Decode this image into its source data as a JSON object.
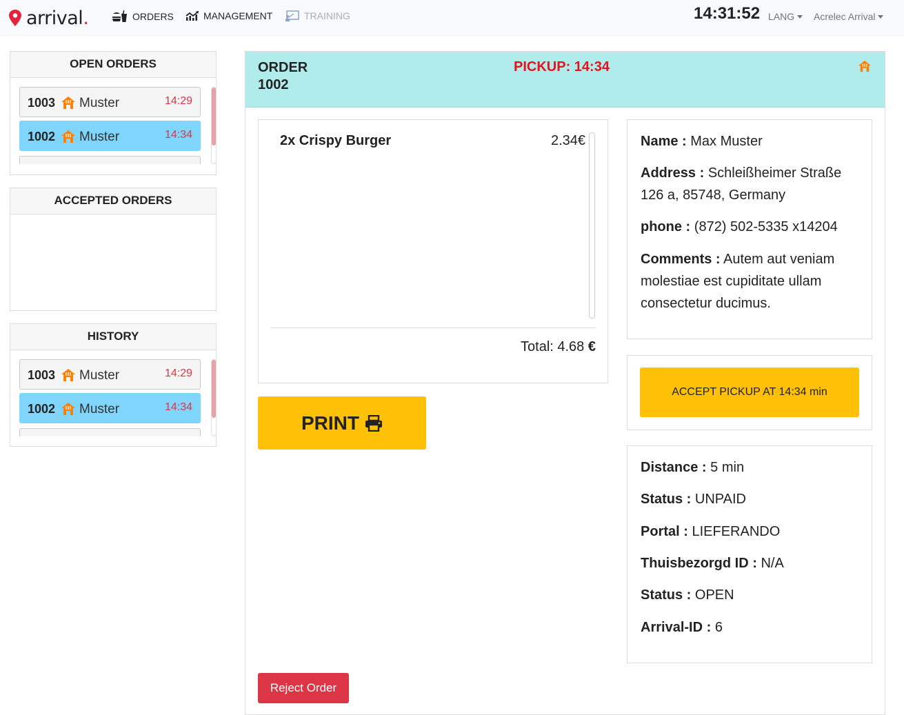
{
  "brand": {
    "name": "arrival",
    "accent_color": "#e2233b"
  },
  "nav": {
    "orders": "ORDERS",
    "management": "MANAGEMENT",
    "training": "TRAINING",
    "clock": "14:31:52",
    "lang": "LANG",
    "user": "Acrelec Arrival"
  },
  "panels": {
    "open_orders": {
      "title": "OPEN ORDERS",
      "items": [
        {
          "id": "1003",
          "name": "Muster",
          "time": "14:29",
          "active": false
        },
        {
          "id": "1002",
          "name": "Muster",
          "time": "14:34",
          "active": true
        }
      ]
    },
    "accepted_orders": {
      "title": "ACCEPTED ORDERS"
    },
    "history": {
      "title": "HISTORY",
      "items": [
        {
          "id": "1003",
          "name": "Muster",
          "time": "14:29",
          "active": false
        },
        {
          "id": "1002",
          "name": "Muster",
          "time": "14:34",
          "active": true
        }
      ]
    }
  },
  "order": {
    "title_line1": "ORDER",
    "title_line2": "1002",
    "pickup": "PICKUP: 14:34",
    "header_color": "#b0ecec",
    "items": [
      {
        "label": "2x Crispy Burger",
        "price": "2.34€"
      }
    ],
    "total_label": "Total: 4.68",
    "total_currency": "€",
    "print_label": "PRINT",
    "customer": {
      "name_key": "Name :",
      "name": "Max Muster",
      "address_key": "Address :",
      "address": "Schleißheimer Straße 126 a, 85748, Germany",
      "phone_key": "phone :",
      "phone": "(872) 502-5335 x14204",
      "comments_key": "Comments :",
      "comments": "Autem aut veniam molestiae est cupiditate ullam consectetur ducimus."
    },
    "accept_label": "ACCEPT PICKUP AT 14:34 min",
    "meta": {
      "distance_key": "Distance :",
      "distance": "5 min",
      "status_key": "Status :",
      "status": "UNPAID",
      "portal_key": "Portal :",
      "portal": "LIEFERANDO",
      "thuis_key": "Thuisbezorgd ID :",
      "thuis": "N/A",
      "status2_key": "Status :",
      "status2": "OPEN",
      "arrival_key": "Arrival-ID :",
      "arrival": "6"
    },
    "reject_label": "Reject Order"
  }
}
